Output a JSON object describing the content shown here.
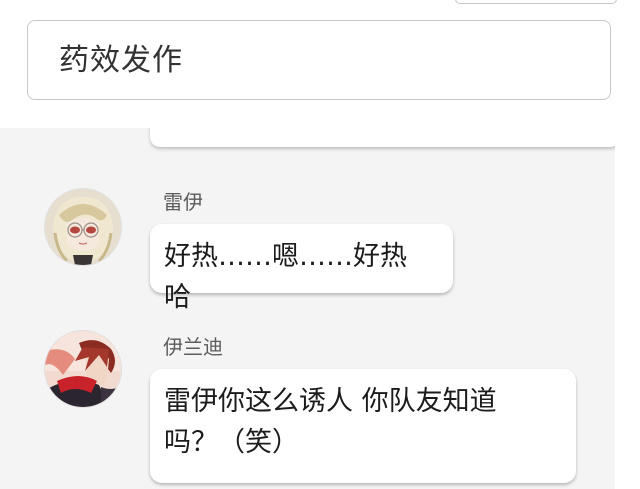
{
  "header": {
    "title": "药效发作"
  },
  "messages": [
    {
      "sender": "雷伊",
      "avatar": "blonde-character-avatar-icon",
      "text": "好热……嗯……好热 哈"
    },
    {
      "sender": "伊兰迪",
      "avatar": "red-hair-character-avatar-icon",
      "text": "雷伊你这么诱人 你队友知道\n吗？（笑）"
    }
  ]
}
